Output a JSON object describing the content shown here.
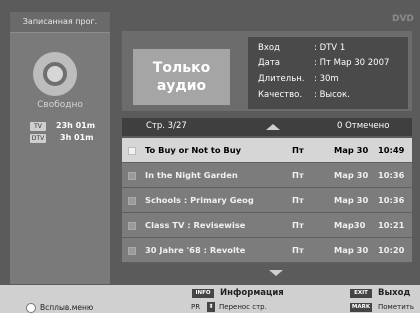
{
  "sidebar": {
    "tab_label": "Записанная прог.",
    "free_label": "Свободно",
    "storage": [
      {
        "badge": "TV",
        "time": "23h 01m"
      },
      {
        "badge": "DTV",
        "time": "3h 01m"
      }
    ]
  },
  "logo": "DVD",
  "info": {
    "audio_only": "Только аудио",
    "rows": [
      {
        "key": "Вход",
        "value": ": DTV 1"
      },
      {
        "key": "Дата",
        "value": ": Пт Мар 30 2007"
      },
      {
        "key": "Длительн.",
        "value": ": 30m"
      },
      {
        "key": "Качество.",
        "value": ": Высок."
      }
    ]
  },
  "list": {
    "page_label": "Стр.  3/27",
    "marked_label": "0 Отмечено",
    "rows": [
      {
        "title": "To Buy or Not to Buy",
        "day": "Пт",
        "date": "Мар 30",
        "time": "10:49",
        "selected": true
      },
      {
        "title": "In the Night Garden",
        "day": "Пт",
        "date": "Мар 30",
        "time": "10:36",
        "selected": false
      },
      {
        "title": "Schools : Primary Geog",
        "day": "Пт",
        "date": "Мар 30",
        "time": "10:36",
        "selected": false
      },
      {
        "title": "Class TV : Revisewise",
        "day": "Пт",
        "date": "Мар30",
        "time": "10:21",
        "selected": false
      },
      {
        "title": "30 Jahre '68 : Revolte",
        "day": "Пт",
        "date": "Мар 30",
        "time": "10:20",
        "selected": false
      }
    ]
  },
  "bottom": {
    "popup_menu": "Всплыв.меню",
    "info_key": "INFO",
    "info_label": "Информация",
    "pr_key": "PR",
    "move_page": "Перенос стр.",
    "exit_key": "EXIT",
    "exit_label": "Выход",
    "mark_key": "MARK",
    "mark_label": "Пометить"
  }
}
